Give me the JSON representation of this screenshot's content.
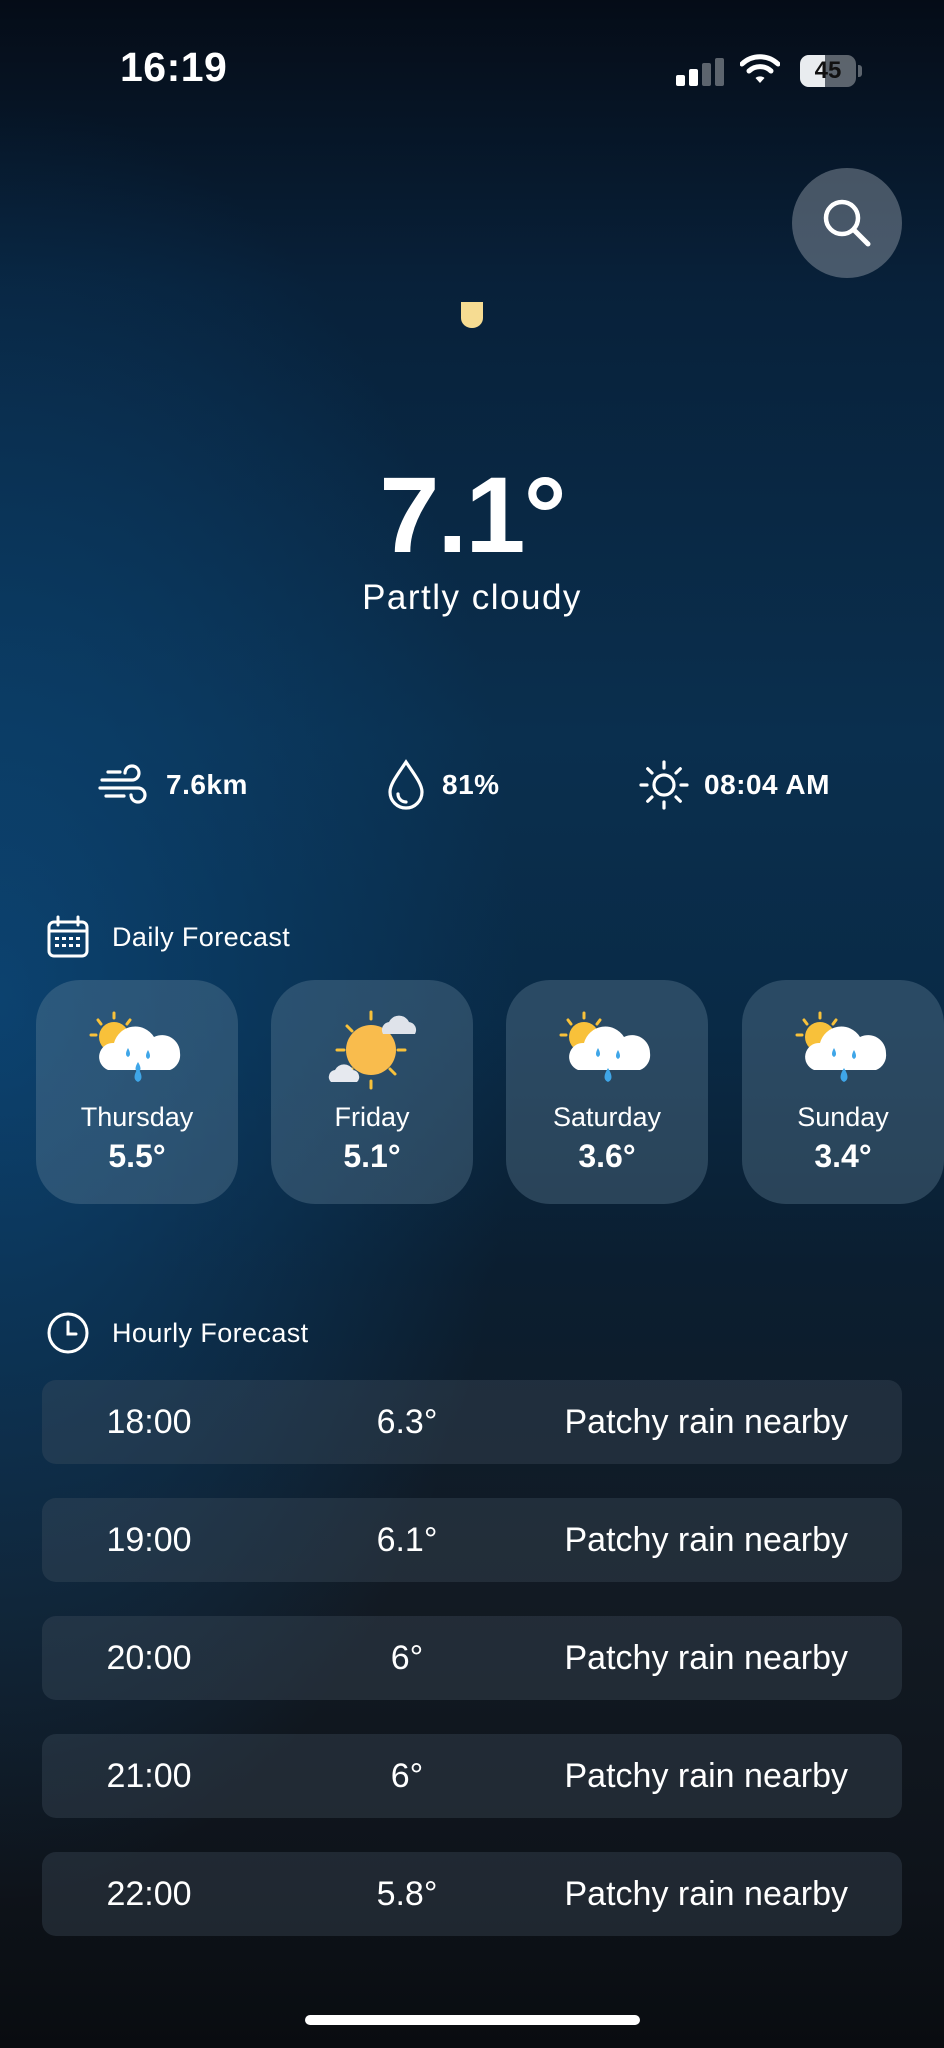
{
  "status_bar": {
    "time": "16:19",
    "battery_level": 45,
    "battery_text": "45",
    "signal_bars_active": 2,
    "signal_bars_total": 4
  },
  "current": {
    "icon": "sun-glyph-icon",
    "temperature": "7.1°",
    "condition": "Partly cloudy"
  },
  "stats": {
    "wind": "7.6km",
    "humidity": "81%",
    "sunrise": "08:04 AM"
  },
  "daily": {
    "title": "Daily Forecast",
    "days": [
      {
        "name": "Thursday",
        "temp": "5.5°",
        "icon": "sun-cloud-rain-icon"
      },
      {
        "name": "Friday",
        "temp": "5.1°",
        "icon": "sun-with-clouds-icon"
      },
      {
        "name": "Saturday",
        "temp": "3.6°",
        "icon": "sun-cloud-rain-icon"
      },
      {
        "name": "Sunday",
        "temp": "3.4°",
        "icon": "sun-cloud-rain-icon"
      }
    ]
  },
  "hourly": {
    "title": "Hourly Forecast",
    "rows": [
      {
        "time": "18:00",
        "temp": "6.3°",
        "condition": "Patchy rain nearby"
      },
      {
        "time": "19:00",
        "temp": "6.1°",
        "condition": "Patchy rain nearby"
      },
      {
        "time": "20:00",
        "temp": "6°",
        "condition": "Patchy rain nearby"
      },
      {
        "time": "21:00",
        "temp": "6°",
        "condition": "Patchy rain nearby"
      },
      {
        "time": "22:00",
        "temp": "5.8°",
        "condition": "Patchy rain nearby"
      }
    ]
  },
  "colors": {
    "sun": "#f8c13a",
    "rain": "#3fa6e8",
    "card": "rgba(110,140,160,0.33)"
  }
}
